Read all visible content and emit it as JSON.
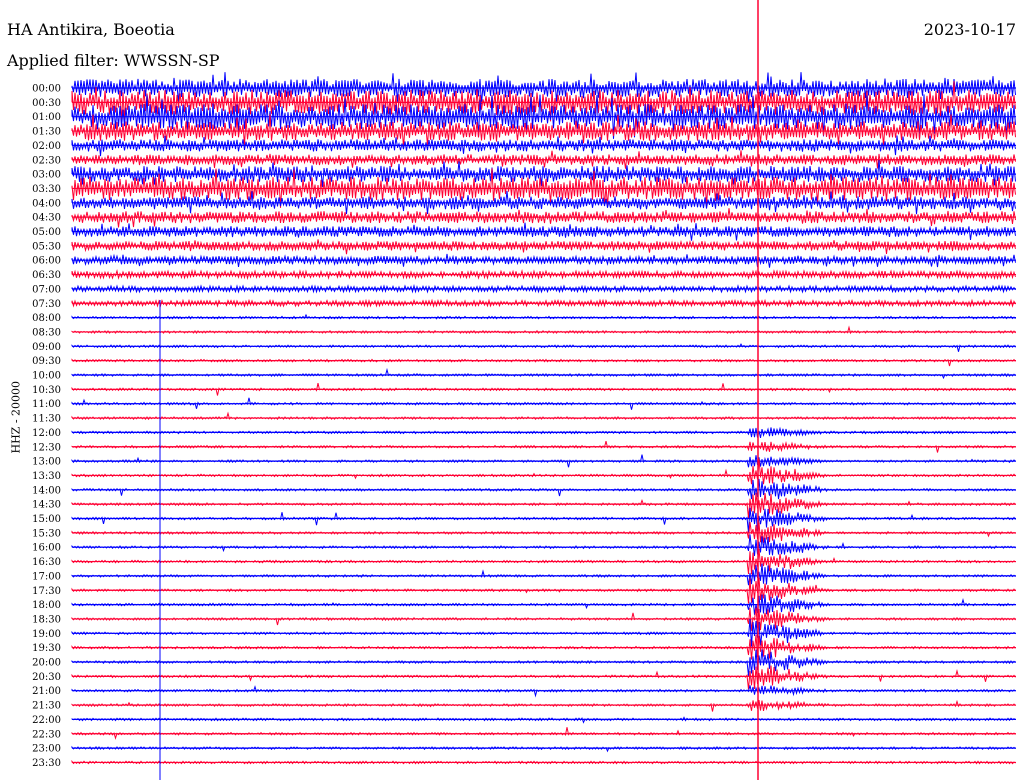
{
  "header": {
    "station": "HA Antikira, Boeotia",
    "date": "2023-10-17",
    "filter": "Applied filter: WWSSN-SP"
  },
  "channel_label": "HHZ - 20000",
  "colors": {
    "trace_a": "#0000ff",
    "trace_b": "#ff0033",
    "marker": "#ff0033"
  },
  "time_labels": [
    "00:00",
    "00:30",
    "01:00",
    "01:30",
    "02:00",
    "02:30",
    "03:00",
    "03:30",
    "04:00",
    "04:30",
    "05:00",
    "05:30",
    "06:00",
    "06:30",
    "07:00",
    "07:30",
    "08:00",
    "08:30",
    "09:00",
    "09:30",
    "10:00",
    "10:30",
    "11:00",
    "11:30",
    "12:00",
    "12:30",
    "13:00",
    "13:30",
    "14:00",
    "14:30",
    "15:00",
    "15:30",
    "16:00",
    "16:30",
    "17:00",
    "17:30",
    "18:00",
    "18:30",
    "19:00",
    "19:30",
    "20:00",
    "20:30",
    "21:00",
    "21:30",
    "22:00",
    "22:30",
    "23:00",
    "23:30"
  ]
}
